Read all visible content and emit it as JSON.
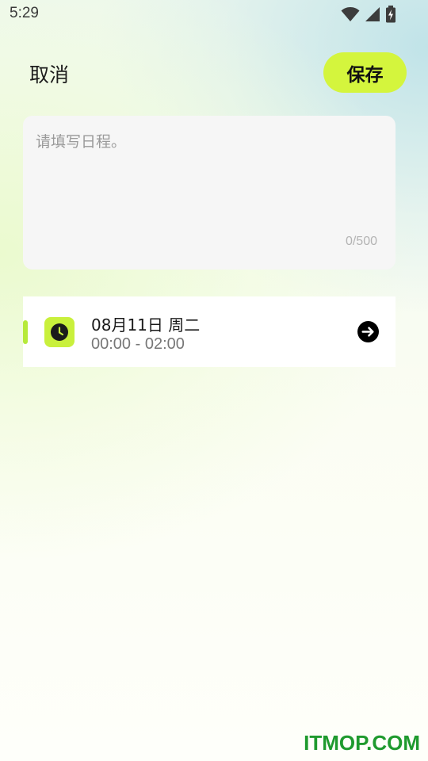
{
  "status_bar": {
    "time": "5:29",
    "icons": [
      "wifi-icon",
      "signal-icon",
      "battery-charging-icon"
    ]
  },
  "header": {
    "cancel_label": "取消",
    "save_label": "保存"
  },
  "editor": {
    "placeholder": "请填写日程。",
    "value": "",
    "counter": "0/500"
  },
  "schedule": {
    "date": "08月11日  周二",
    "time_range": "00:00 - 02:00",
    "icon": "clock-icon",
    "action_icon": "arrow-right-circle-icon"
  },
  "watermark": "ITMOP.COM",
  "colors": {
    "accent": "#d4f53d",
    "accent_bar": "#b6ea3a",
    "watermark": "#1e9a2e"
  }
}
